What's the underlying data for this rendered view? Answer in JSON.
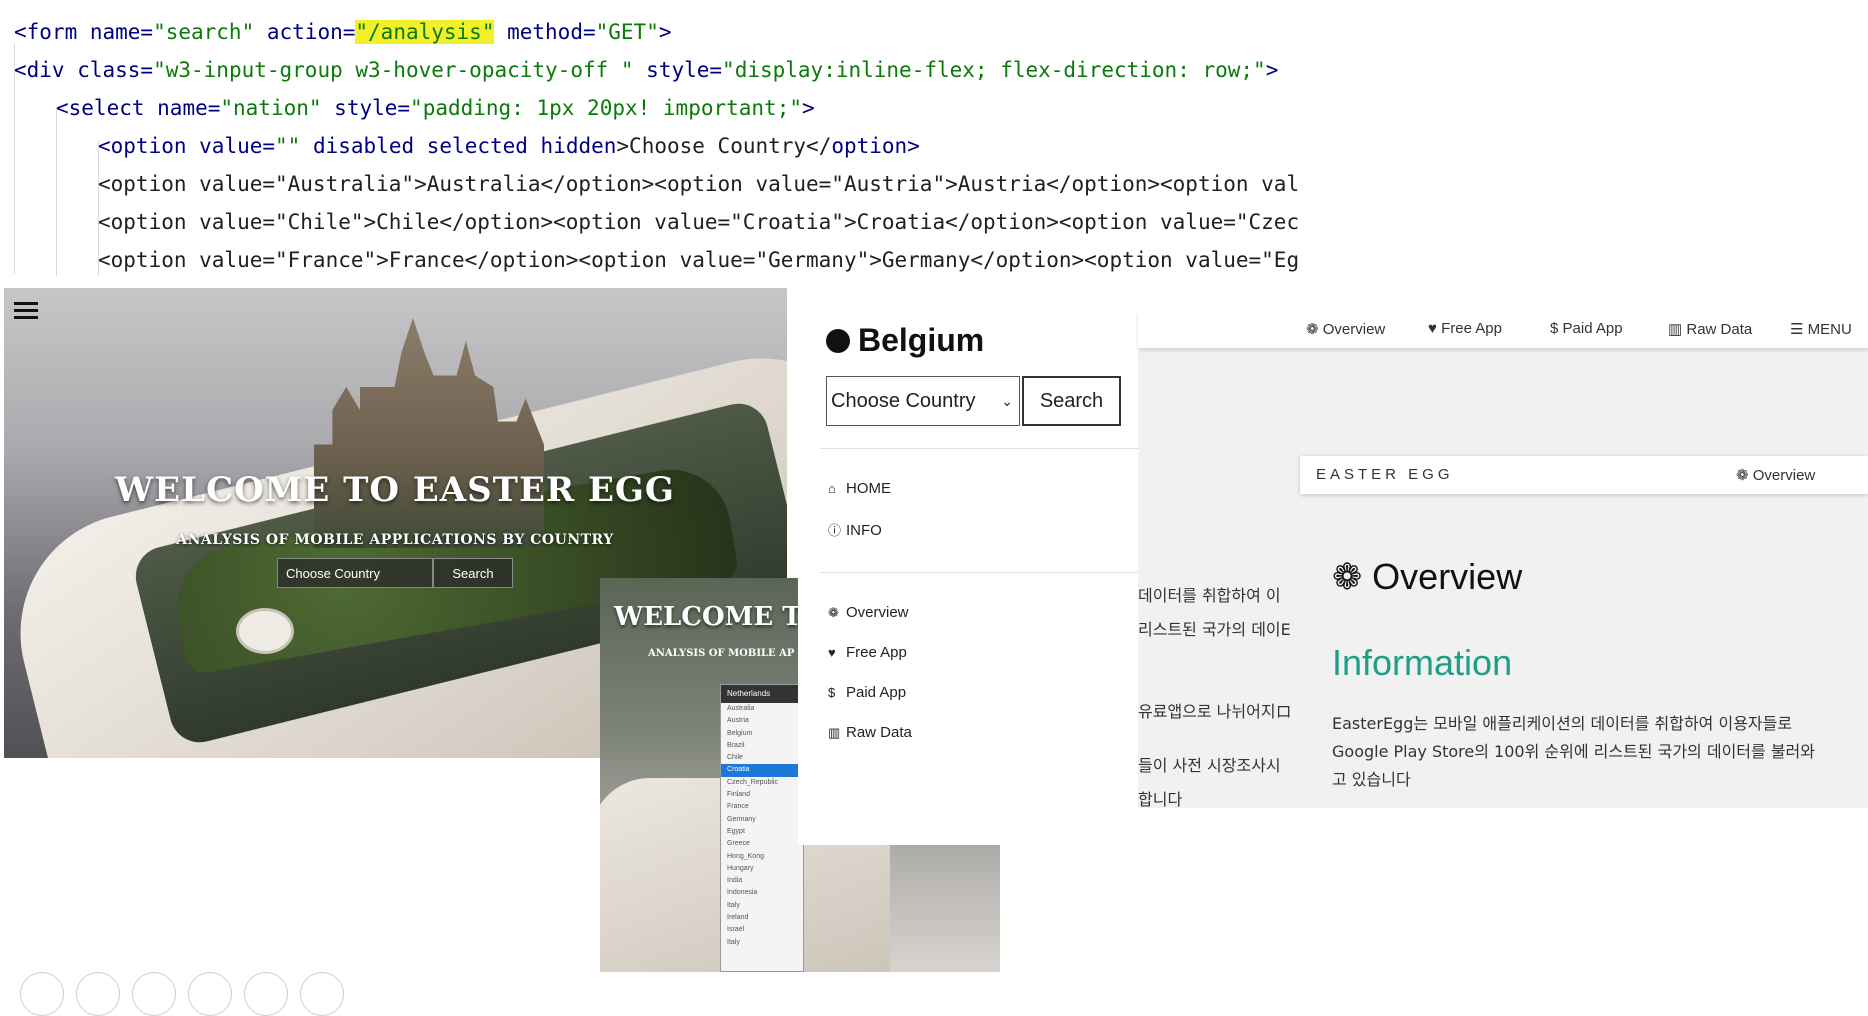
{
  "code": {
    "line1": {
      "tag": "<form",
      "attr1": " name=",
      "val1": "\"search\"",
      "attr2": " action=",
      "val2": "\"/analysis\"",
      "attr3": " method=",
      "val3": "\"GET\"",
      "end": ">"
    },
    "line2": {
      "tag": "<div",
      "attr1": " class=",
      "val1": "\"w3-input-group w3-hover-opacity-off \"",
      "attr2": " style=",
      "val2": "\"display:inline-flex; flex-direction: row;\"",
      "end": ">"
    },
    "line3": {
      "tag": "<select",
      "attr1": " name=",
      "val1": "\"nation\"",
      "attr2": " style=",
      "val2": "\"padding: 1px 20px! important;\"",
      "end": ">"
    },
    "line4": {
      "tag": "<option",
      "attr1": " value=",
      "val1": "\"\"",
      "plain": " disabled selected hidden",
      "text": ">Choose Country</",
      "close": "option",
      "end": ">"
    },
    "line5": "<option value=\"Australia\">Australia</option><option value=\"Austria\">Austria</option><option val",
    "line6": "<option value=\"Chile\">Chile</option><option value=\"Croatia\">Croatia</option><option value=\"Czec",
    "line7": "<option value=\"France\">France</option><option value=\"Germany\">Germany</option><option value=\"Eg"
  },
  "hero": {
    "title": "Welcome to Easter Egg",
    "subtitle": "Analysis of mobile applications by country",
    "select_placeholder": "Choose Country",
    "search_label": "Search"
  },
  "hero2": {
    "title": "WELCOME TO",
    "subtitle": "ANALYSIS OF MOBILE AP",
    "selected": "Netherlands",
    "options": [
      "Australia",
      "Austria",
      "Belgium",
      "Brazil",
      "Chile",
      "Croatia",
      "Czech_Republic",
      "Finland",
      "France",
      "Germany",
      "Egypt",
      "Greece",
      "Hong_Kong",
      "Hungary",
      "India",
      "Indonesia",
      "Italy",
      "Ireland",
      "Israel",
      "Italy"
    ],
    "active_option": "Croatia"
  },
  "sidebar": {
    "country": "Belgium",
    "select_value": "Choose Country",
    "search_label": "Search",
    "nav_main": [
      {
        "label": "HOME",
        "icon": "home-icon",
        "glyph": "⌂"
      },
      {
        "label": "INFO",
        "icon": "info-icon",
        "glyph": "ⓘ"
      }
    ],
    "nav_sections": [
      {
        "label": "Overview",
        "icon": "paw-icon",
        "glyph": "❁"
      },
      {
        "label": "Free App",
        "icon": "heart-icon",
        "glyph": "♥"
      },
      {
        "label": "Paid App",
        "icon": "dollar-icon",
        "glyph": "$"
      },
      {
        "label": "Raw Data",
        "icon": "bar-chart-icon",
        "glyph": "▥"
      }
    ]
  },
  "topnav": [
    {
      "label": "Overview",
      "icon": "paw-icon",
      "glyph": "❁"
    },
    {
      "label": "Free App",
      "icon": "heart-icon",
      "glyph": "♥"
    },
    {
      "label": "Paid App",
      "icon": "dollar-icon",
      "glyph": "$"
    },
    {
      "label": "Raw Data",
      "icon": "bar-chart-icon",
      "glyph": "▥"
    },
    {
      "label": "MENU",
      "icon": "menu-icon",
      "glyph": "☰"
    }
  ],
  "panel": {
    "easter_label": "EASTER EGG",
    "easter_overview": "Overview",
    "overview_heading": "Overview",
    "info_heading": "Information",
    "para1": "EasterEgg는 모바일 애플리케이션의 데이터를 취합하여 이용자들로",
    "para2": "Google Play Store의 100위 순위에 리스트된 국가의 데이터를 불러와",
    "para3": "고 있습니다",
    "left_frag1": "데이터를 취합하여 이",
    "left_frag2": "리스트된 국가의 데이E",
    "left_frag3": "유료앱으로 나뉘어지ロ",
    "left_frag4": "들이 사전 시장조사시",
    "left_frag5": "합니다"
  },
  "colors": {
    "accent": "#1f9e87",
    "highlight": "#f2f02a",
    "keyword": "#000080",
    "string": "#0a7a0a"
  }
}
